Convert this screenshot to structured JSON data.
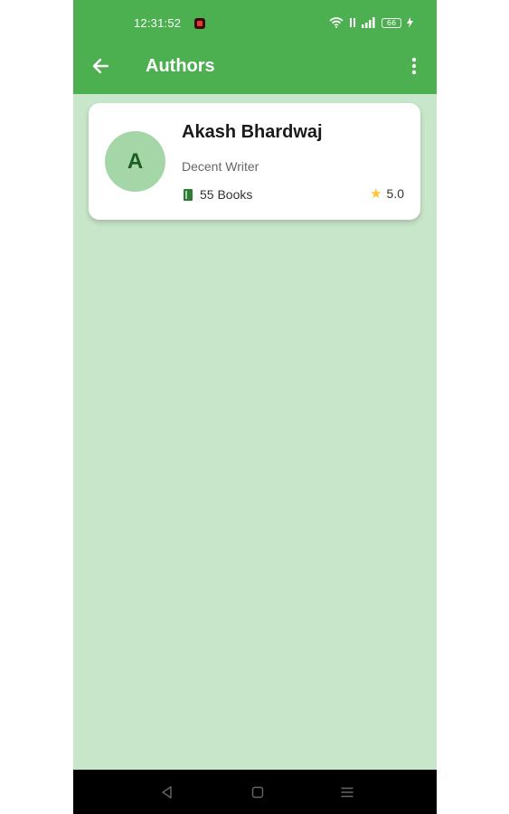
{
  "status_bar": {
    "time": "12:31:52",
    "battery_level": "66"
  },
  "app_bar": {
    "title": "Authors",
    "back_icon": "arrow-left-icon",
    "menu_icon": "more-vert-icon"
  },
  "authors": [
    {
      "initial": "A",
      "name": "Akash Bhardwaj",
      "description": "Decent Writer",
      "books": "55 Books",
      "rating": "5.0"
    }
  ],
  "colors": {
    "app_bar": "#4caf50",
    "background": "#c8e6c9",
    "avatar": "#a5d6a7",
    "star": "#f9c62b"
  },
  "nav_bar": {
    "icons": [
      "back-triangle-icon",
      "home-square-icon",
      "recents-menu-icon"
    ]
  }
}
